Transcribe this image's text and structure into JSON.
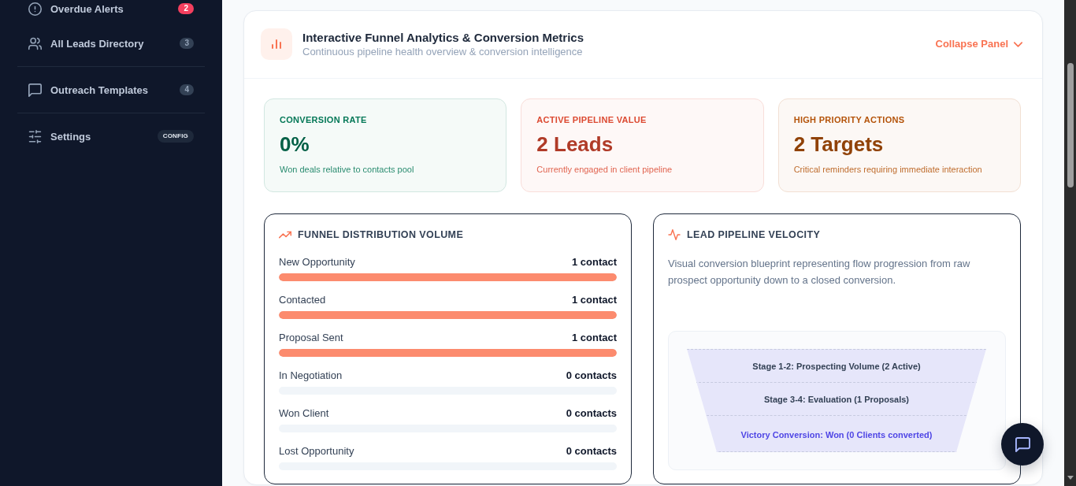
{
  "sidebar": {
    "groups": [
      {
        "items": [
          {
            "label": "Overdue Alerts",
            "selected": false,
            "badge": {
              "text": "2",
              "kind": "alert"
            }
          },
          {
            "label": "All Leads Directory",
            "selected": false,
            "badge": {
              "text": "3",
              "kind": "count"
            }
          }
        ]
      },
      {
        "items": [
          {
            "label": "Outreach Templates",
            "selected": false,
            "badge": {
              "text": "4",
              "kind": "count"
            }
          }
        ]
      },
      {
        "items": [
          {
            "label": "Settings",
            "selected": false,
            "badge": {
              "text": "CONFIG",
              "kind": "tag"
            }
          }
        ]
      }
    ]
  },
  "panel": {
    "title": "Interactive Funnel Analytics & Conversion Metrics",
    "subtitle": "Continuous pipeline health overview & conversion intelligence",
    "collapse_button": "Collapse Panel"
  },
  "stats": [
    {
      "label": "CONVERSION RATE",
      "value": "0%",
      "description": "Won deals relative to contacts pool",
      "color": "#047857"
    },
    {
      "label": "ACTIVE PIPELINE VALUE",
      "value": "2 Leads",
      "description": "Currently engaged in client pipeline",
      "color": "#dc4a32"
    },
    {
      "label": "HIGH PRIORITY ACTIONS",
      "value": "2 Targets",
      "description": "Critical reminders requiring immediate interaction",
      "color": "#b45309"
    }
  ],
  "funnel": {
    "title": "FUNNEL DISTRIBUTION VOLUME",
    "rows": [
      {
        "label": "New Opportunity",
        "count": "1 contact",
        "level": 1
      },
      {
        "label": "Contacted",
        "count": "1 contact",
        "level": 1
      },
      {
        "label": "Proposal Sent",
        "count": "1 contact",
        "level": 1
      },
      {
        "label": "In Negotiation",
        "count": "0 contacts",
        "level": 0
      },
      {
        "label": "Won Client",
        "count": "0 contacts",
        "level": 0
      },
      {
        "label": "Lost Opportunity",
        "count": "0 contacts",
        "level": 0
      }
    ]
  },
  "velocity": {
    "title": "LEAD PIPELINE VELOCITY",
    "description": "Visual conversion blueprint representing flow progression from raw prospect opportunity down to a closed conversion.",
    "stages": [
      {
        "label": "Stage 1-2: Prospecting Volume (2 Active)",
        "kind": "stage"
      },
      {
        "label": "Stage 3-4: Evaluation (1 Proposals)",
        "kind": "stage"
      },
      {
        "label": "Victory Conversion: Won (0 Clients converted)",
        "kind": "outcome"
      }
    ]
  }
}
